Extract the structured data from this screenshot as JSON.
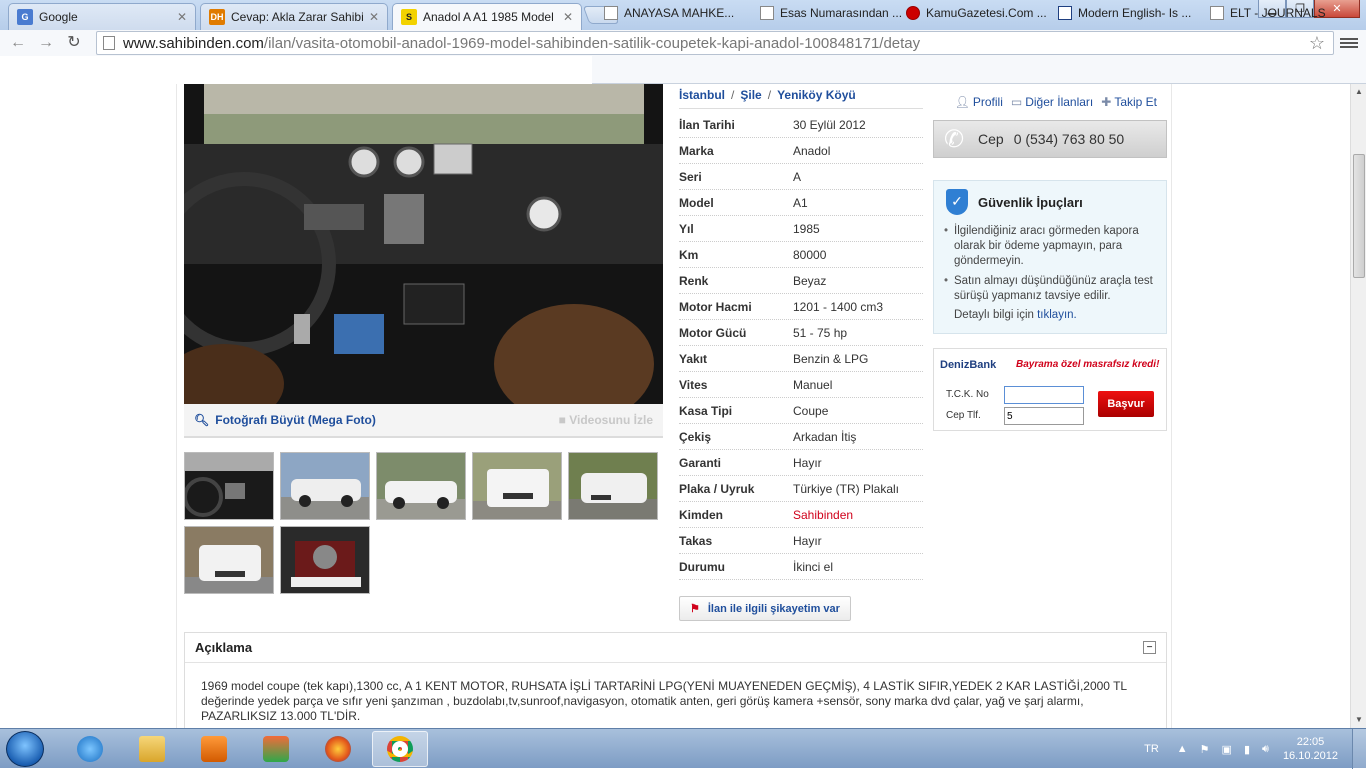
{
  "browser": {
    "tabs": [
      {
        "label": "Google",
        "favicon": "G",
        "color": "#4a7bd0"
      },
      {
        "label": "Cevap: Akla Zarar Sahibind",
        "favicon": "DH",
        "color": "#e07b00"
      },
      {
        "label": "Anadol A A1 1985 Model 1:",
        "favicon": "S",
        "color": "#f2d200"
      }
    ],
    "url_host": "www.sahibinden.com",
    "url_path": "/ilan/vasita-otomobil-anadol-1969-model-sahibinden-satilik-coupetek-kapi-anadol-100848171/detay",
    "bookmarks": [
      "ANAYASA MAHKE...",
      "Esas Numarasından ...",
      "KamuGazetesi.Com ...",
      "Modern English- Is ...",
      "ELT - JOURNALS"
    ]
  },
  "listing": {
    "breadcrumb": [
      "İstanbul",
      "Şile",
      "Yeniköy Köyü"
    ],
    "photo_zoom_label": "Fotoğrafı Büyüt (Mega Foto)",
    "video_label": "Videosunu İzle",
    "details": [
      {
        "key": "İlan Tarihi",
        "value": "30 Eylül 2012"
      },
      {
        "key": "Marka",
        "value": "Anadol"
      },
      {
        "key": "Seri",
        "value": "A"
      },
      {
        "key": "Model",
        "value": "A1"
      },
      {
        "key": "Yıl",
        "value": "1985"
      },
      {
        "key": "Km",
        "value": "80000"
      },
      {
        "key": "Renk",
        "value": "Beyaz"
      },
      {
        "key": "Motor Hacmi",
        "value": "1201 - 1400 cm3"
      },
      {
        "key": "Motor Gücü",
        "value": "51 - 75 hp"
      },
      {
        "key": "Yakıt",
        "value": "Benzin & LPG"
      },
      {
        "key": "Vites",
        "value": "Manuel"
      },
      {
        "key": "Kasa Tipi",
        "value": "Coupe"
      },
      {
        "key": "Çekiş",
        "value": "Arkadan İtiş"
      },
      {
        "key": "Garanti",
        "value": "Hayır"
      },
      {
        "key": "Plaka / Uyruk",
        "value": "Türkiye (TR) Plakalı"
      },
      {
        "key": "Kimden",
        "value": "Sahibinden"
      },
      {
        "key": "Takas",
        "value": "Hayır"
      },
      {
        "key": "Durumu",
        "value": "İkinci el"
      }
    ],
    "complain_label": "İlan ile ilgili şikayetim var"
  },
  "seller": {
    "profile_label": "Profili",
    "other_ads_label": "Diğer İlanları",
    "follow_label": "Takip Et",
    "phone_label": "Cep",
    "phone": "0 (534) 763 80 50"
  },
  "security": {
    "title": "Güvenlik İpuçları",
    "tips": [
      "İlgilendiğiniz aracı görmeden kapora olarak bir ödeme yapmayın, para göndermeyin.",
      "Satın almayı düşündüğünüz araçla test sürüşü yapmanız tavsiye edilir."
    ],
    "more_prefix": "Detaylı bilgi için",
    "more_link": "tıklayın."
  },
  "ad": {
    "brand": "DenizBank",
    "promo": "Bayrama özel masrafsız kredi!",
    "tck_label": "T.C.K. No",
    "tck_value": "",
    "phone_label": "Cep Tlf.",
    "phone_value": "5",
    "button": "Başvur"
  },
  "description": {
    "title": "Açıklama",
    "collapse": "−",
    "text": "1969 model coupe (tek kapı),1300 cc, A 1 KENT MOTOR, RUHSATA İŞLİ TARTARİNİ LPG(YENİ MUAYENEDEN GEÇMİŞ), 4 LASTİK SIFIR,YEDEK 2 KAR LASTİĞİ,2000 TL değerinde yedek parça ve sıfır yeni şanzıman , buzdolabı,tv,sunroof,navigasyon, otomatik anten, geri görüş kamera +sensör, sony marka dvd çalar, yağ ve şarj alarmı, PAZARLIKSIZ 13.000 TL'DİR."
  },
  "taskbar": {
    "lang": "TR",
    "time": "22:05",
    "date": "16.10.2012"
  },
  "colors": {
    "link": "#1f4e9c",
    "red": "#d0021b"
  }
}
